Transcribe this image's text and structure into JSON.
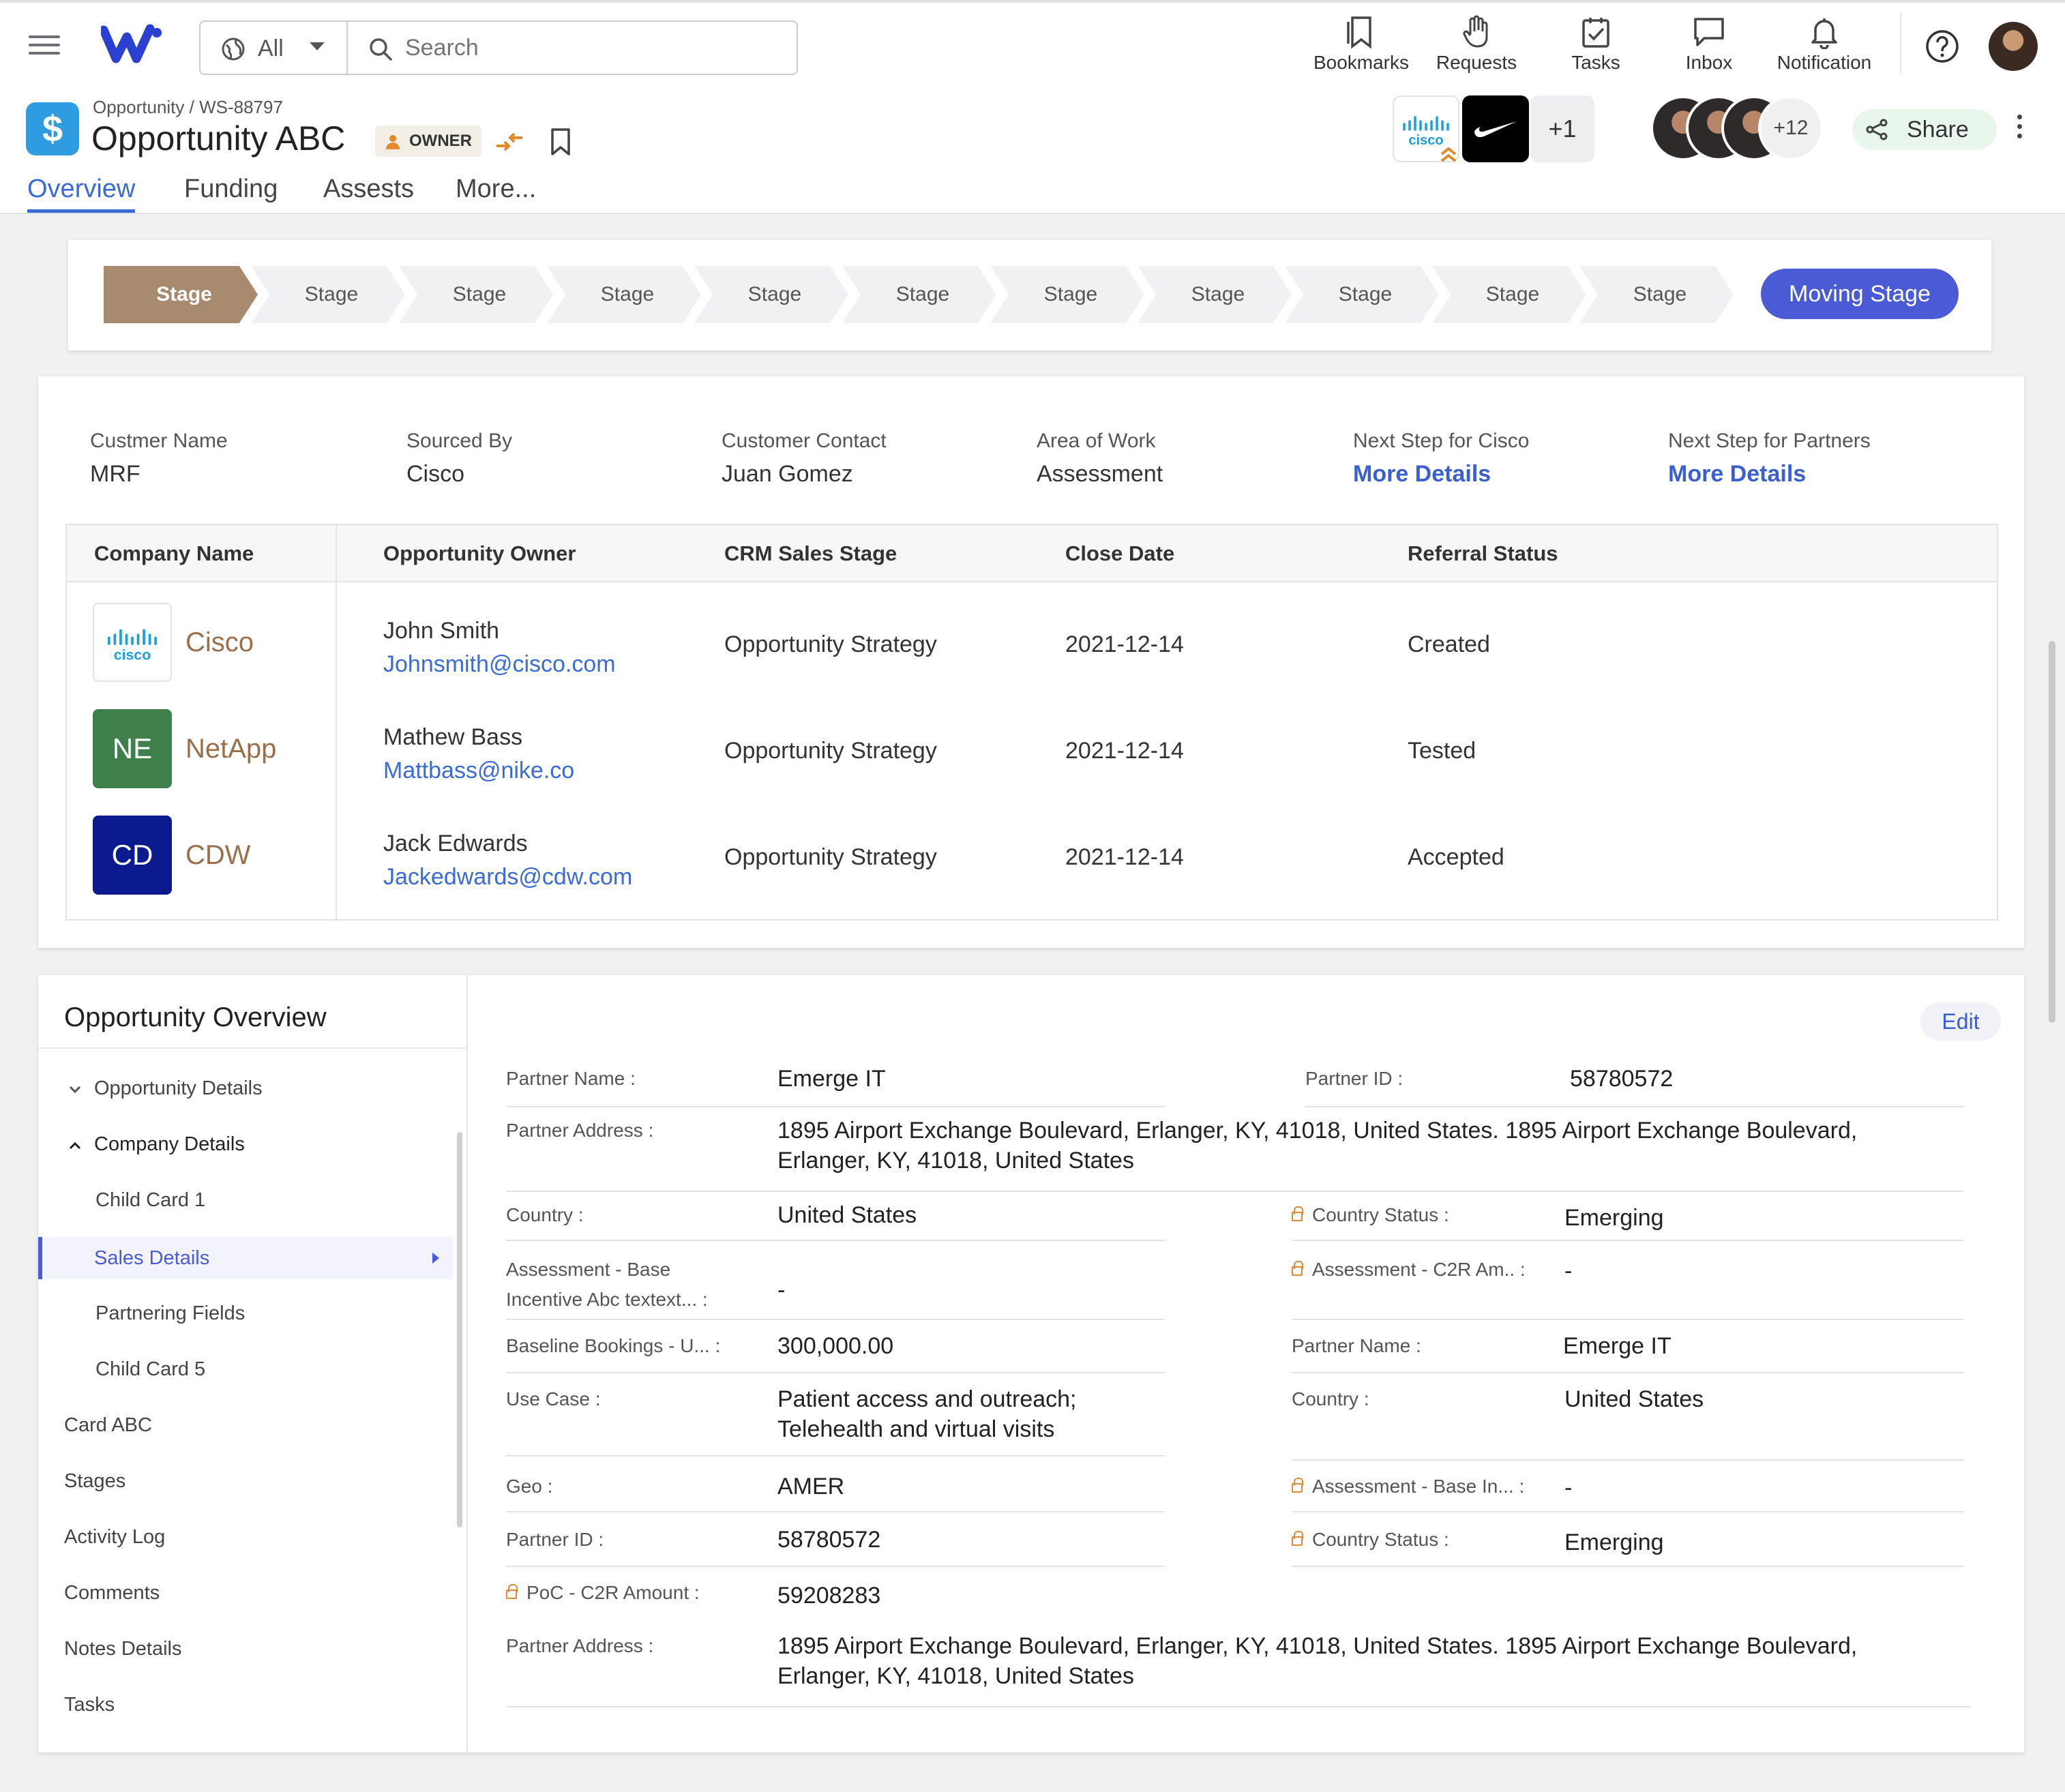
{
  "topbar": {
    "scope": "All",
    "search_placeholder": "Search",
    "nav": [
      {
        "label": "Bookmarks",
        "icon": "bookmarks-icon"
      },
      {
        "label": "Requests",
        "icon": "hand-icon"
      },
      {
        "label": "Tasks",
        "icon": "tasks-icon"
      },
      {
        "label": "Inbox",
        "icon": "inbox-icon"
      },
      {
        "label": "Notification",
        "icon": "bell-icon"
      }
    ]
  },
  "header": {
    "breadcrumb": "Opportunity / WS-88797",
    "title": "Opportunity ABC",
    "owner_badge": "OWNER",
    "partner_more": "+1",
    "people_more": "+12",
    "share_label": "Share",
    "tabs": [
      "Overview",
      "Funding",
      "Assests",
      "More..."
    ]
  },
  "stages": {
    "items": [
      "Stage",
      "Stage",
      "Stage",
      "Stage",
      "Stage",
      "Stage",
      "Stage",
      "Stage",
      "Stage",
      "Stage",
      "Stage"
    ],
    "action": "Moving Stage"
  },
  "summary": [
    {
      "label": "Custmer Name",
      "value": "MRF"
    },
    {
      "label": "Sourced By",
      "value": "Cisco"
    },
    {
      "label": "Customer Contact",
      "value": "Juan Gomez"
    },
    {
      "label": "Area of Work",
      "value": "Assessment"
    },
    {
      "label": "Next Step for Cisco",
      "value": "More Details"
    },
    {
      "label": "Next Step for Partners",
      "value": "More Details"
    }
  ],
  "companies": {
    "columns": [
      "Company Name",
      "Opportunity Owner",
      "CRM Sales Stage",
      "Close Date",
      "Referral Status"
    ],
    "rows": [
      {
        "initials": "",
        "name": "Cisco",
        "owner": "John Smith",
        "email": "Johnsmith@cisco.com",
        "stage": "Opportunity Strategy",
        "date": "2021-12-14",
        "status": "Created"
      },
      {
        "initials": "NE",
        "name": "NetApp",
        "owner": "Mathew Bass",
        "email": "Mattbass@nike.co",
        "stage": "Opportunity Strategy",
        "date": "2021-12-14",
        "status": "Tested"
      },
      {
        "initials": "CD",
        "name": "CDW",
        "owner": "Jack Edwards",
        "email": "Jackedwards@cdw.com",
        "stage": "Opportunity Strategy",
        "date": "2021-12-14",
        "status": "Accepted"
      }
    ]
  },
  "overview_nav": {
    "title": "Opportunity Overview",
    "items": [
      "Opportunity Details",
      "Company Details",
      "Child Card 1",
      "Sales Details",
      "Partnering Fields",
      "Child Card 5",
      "Card ABC",
      "Stages",
      "Activity Log",
      "Comments",
      "Notes Details",
      "Tasks"
    ]
  },
  "details": {
    "edit": "Edit",
    "fields": {
      "partner_name_l": "Partner Name :",
      "partner_name_v": "Emerge IT",
      "partner_id_l": "Partner ID :",
      "partner_id_v": "58780572",
      "partner_address_l": "Partner Address :",
      "partner_address_v": "1895 Airport Exchange Boulevard, Erlanger, KY, 41018, United States. 1895 Airport Exchange Boulevard, Erlanger, KY, 41018, United States",
      "country_l": "Country :",
      "country_v": "United States",
      "country_status_l": "Country Status :",
      "country_status_v": "Emerging",
      "assess_base_l": "Assessment - Base Incentive Abc textext... :",
      "assess_base_v": "-",
      "assess_c2r_l": "Assessment - C2R Am.. :",
      "assess_c2r_v": "-",
      "baseline_l": "Baseline Bookings - U... :",
      "baseline_v": "300,000.00",
      "partner_name2_l": "Partner Name :",
      "partner_name2_v": "Emerge IT",
      "use_case_l": "Use Case :",
      "use_case_v": "Patient access and outreach; Telehealth and virtual visits",
      "country2_l": "Country :",
      "country2_v": "United States",
      "geo_l": "Geo :",
      "geo_v": "AMER",
      "assess_base2_l": "Assessment - Base In... :",
      "assess_base2_v": "-",
      "partner_id2_l": "Partner ID :",
      "partner_id2_v": "58780572",
      "country_status2_l": "Country Status :",
      "country_status2_v": "Emerging",
      "poc_l": "PoC - C2R Amount :",
      "poc_v": "59208283",
      "partner_address2_l": "Partner Address :",
      "partner_address2_v": "1895 Airport Exchange Boulevard, Erlanger, KY, 41018, United States. 1895 Airport Exchange Boulevard, Erlanger, KY, 41018, United States"
    }
  }
}
